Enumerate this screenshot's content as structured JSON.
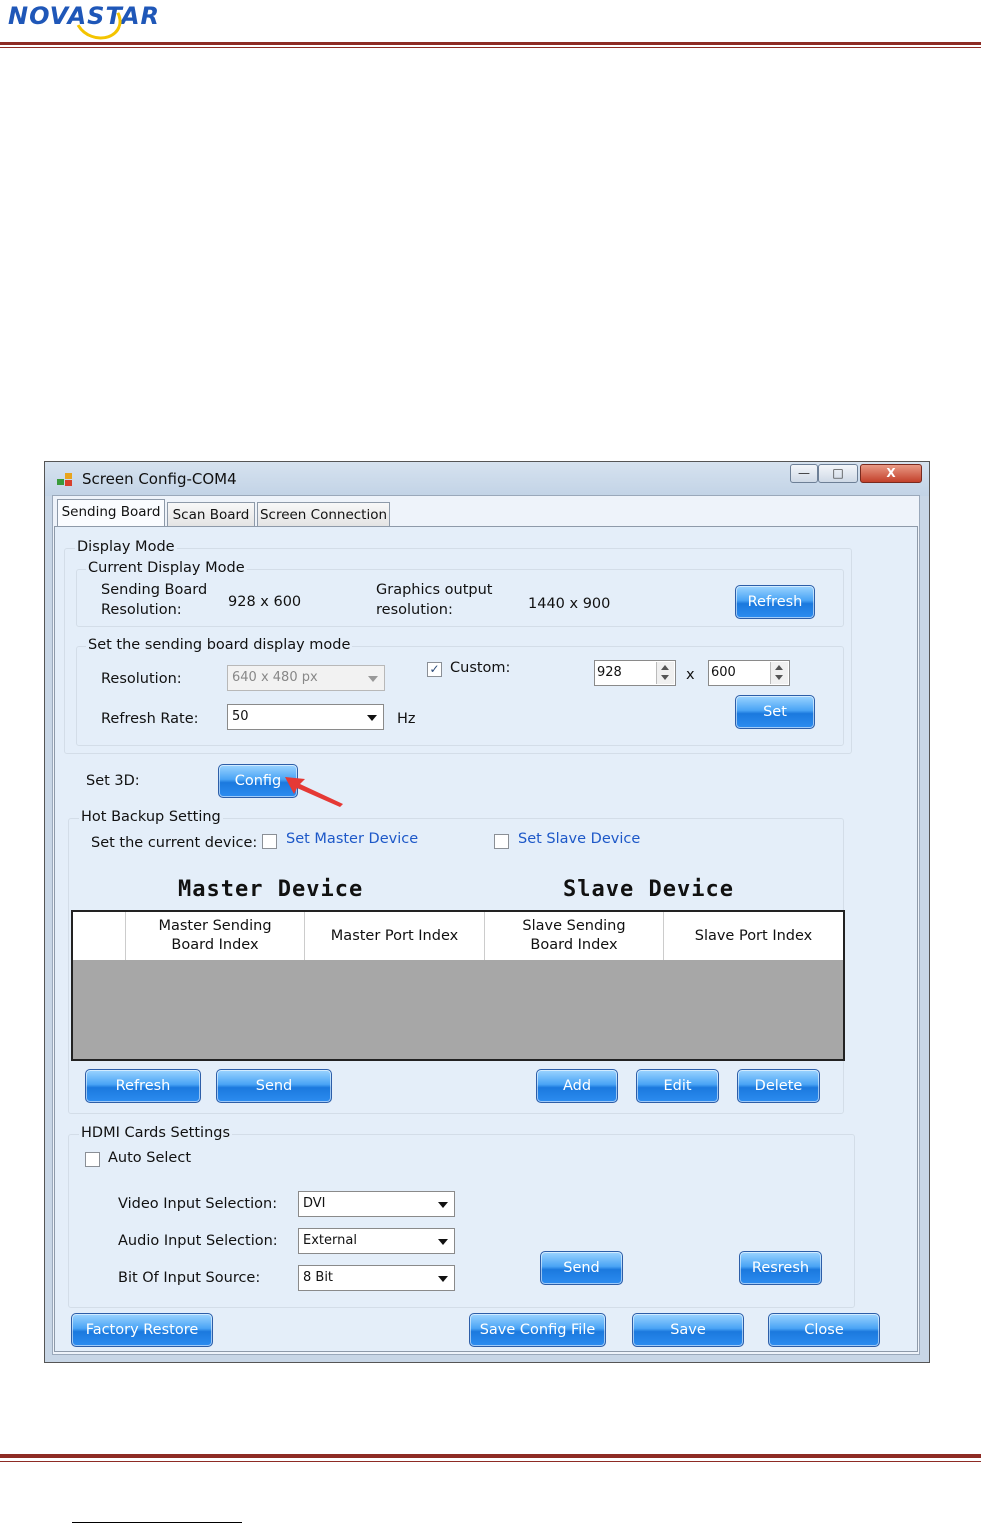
{
  "page": {
    "logo_text": "NOVASTAR"
  },
  "window": {
    "title": "Screen Config-COM4",
    "controls": {
      "minimize": "—",
      "maximize": "□",
      "close": "X"
    },
    "tabs": [
      {
        "label": "Sending Board",
        "active": true
      },
      {
        "label": "Scan Board",
        "active": false
      },
      {
        "label": "Screen Connection",
        "active": false
      }
    ]
  },
  "display_mode": {
    "group_title": "Display Mode",
    "current": {
      "title": "Current Display Mode",
      "sending_label_1": "Sending Board",
      "sending_label_2": "Resolution:",
      "sending_value": "928 x 600",
      "graphics_label_1": "Graphics output",
      "graphics_label_2": "resolution:",
      "graphics_value": "1440 x 900",
      "refresh_button": "Refresh"
    },
    "set_mode": {
      "title": "Set the sending board display mode",
      "resolution_label": "Resolution:",
      "resolution_value": "640 x 480 px",
      "custom_label": "Custom:",
      "custom_checked": true,
      "width_value": "928",
      "x_label": "x",
      "height_value": "600",
      "refresh_rate_label": "Refresh Rate:",
      "refresh_rate_value": "50",
      "hz_label": "Hz",
      "set_button": "Set"
    }
  },
  "set3d": {
    "label": "Set 3D:",
    "config_button": "Config"
  },
  "hot_backup": {
    "title": "Hot Backup Setting",
    "current_device_label": "Set the current device:",
    "master_option": "Set Master Device",
    "slave_option": "Set Slave Device",
    "master_heading": "Master Device",
    "slave_heading": "Slave Device",
    "columns": [
      {
        "line1": "",
        "line2": ""
      },
      {
        "line1": "Master Sending",
        "line2": "Board Index"
      },
      {
        "line1": "Master Port Index",
        "line2": ""
      },
      {
        "line1": "Slave Sending",
        "line2": "Board Index"
      },
      {
        "line1": "Slave Port Index",
        "line2": ""
      }
    ],
    "buttons": {
      "refresh": "Refresh",
      "send": "Send",
      "add": "Add",
      "edit": "Edit",
      "delete": "Delete"
    }
  },
  "hdmi": {
    "title": "HDMI Cards Settings",
    "auto_select_label": "Auto Select",
    "video_label": "Video Input Selection:",
    "video_value": "DVI",
    "audio_label": "Audio Input Selection:",
    "audio_value": "External",
    "bit_label": "Bit Of Input Source:",
    "bit_value": "8 Bit",
    "send_button": "Send",
    "refresh_button": "Resresh"
  },
  "footer_buttons": {
    "factory_restore": "Factory Restore",
    "save_config_file": "Save Config File",
    "save": "Save",
    "close": "Close"
  },
  "colors": {
    "button_blue": "#2c8cf0",
    "rule_red": "#8e2b24",
    "link_blue": "#1d58c8",
    "arrow_red": "#e53935"
  }
}
